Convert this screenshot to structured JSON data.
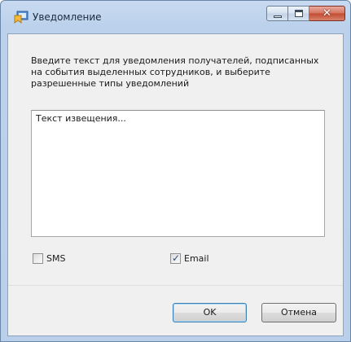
{
  "window": {
    "title": "Уведомление",
    "icon": "notification-app-icon",
    "minimize_icon": "minimize-icon",
    "maximize_icon": "maximize-icon",
    "close_icon": "close-icon",
    "close_glyph": "✕"
  },
  "dialog": {
    "prompt": "Введите текст для уведомления получателей, подписанных на события выделенных сотрудников, и выберите разрешенные типы уведомлений",
    "message_value": "Текст извещения...",
    "options": {
      "sms": {
        "label": "SMS",
        "checked": false
      },
      "email": {
        "label": "Email",
        "checked": true
      }
    },
    "buttons": {
      "ok_label": "OK",
      "cancel_label": "Отмена"
    }
  },
  "colors": {
    "titlebar": "#bcd2ec",
    "client": "#f0f0f0",
    "close_button": "#c24a30",
    "default_button_border": "#3c7fb1"
  }
}
